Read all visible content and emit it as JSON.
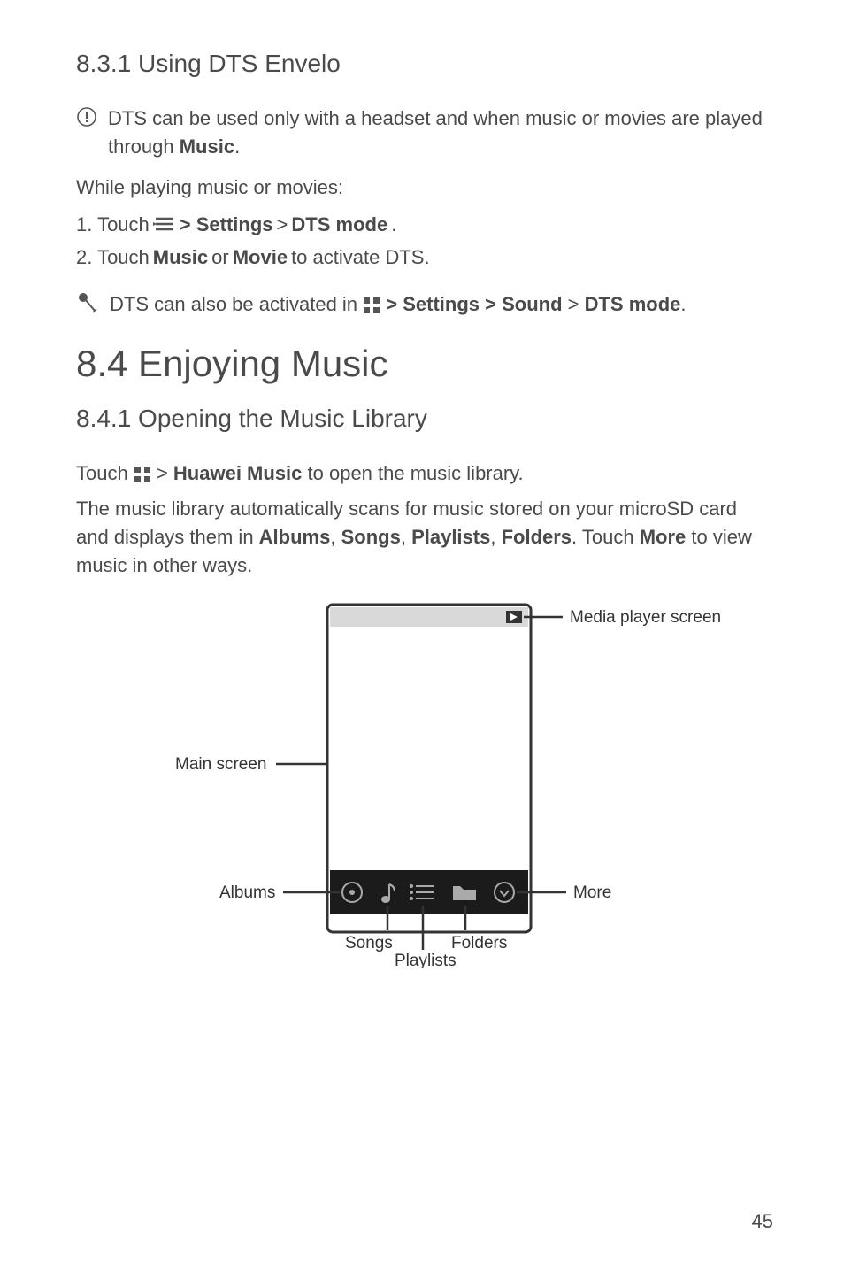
{
  "section_8_3_1": {
    "heading": "8.3.1  Using DTS Envelo",
    "note": {
      "pre": "DTS can be used only with a headset and when music or movies are played through ",
      "bold": "Music",
      "post": "."
    },
    "intro": "While playing music or movies:",
    "step1": {
      "pre": "1. Touch ",
      "mid": " > Settings",
      "gt": " > ",
      "bold2": "DTS mode",
      "post": "."
    },
    "step2": {
      "pre": "2.  Touch ",
      "b1": "Music",
      "or": " or ",
      "b2": "Movie",
      "post": " to activate DTS."
    },
    "tip": {
      "pre": "DTS can also be activated in ",
      "mid": " > Settings > Sound",
      "gt": " > ",
      "bold2": "DTS mode",
      "post": "."
    }
  },
  "section_8_4": {
    "heading": "8.4  Enjoying Music"
  },
  "section_8_4_1": {
    "heading": "8.4.1  Opening the Music Library",
    "line1": {
      "pre": "Touch ",
      "gt": " > ",
      "bold": "Huawei Music",
      "post": " to open the music library."
    },
    "para2_a": "The music library automatically scans for music stored on your microSD card and displays them in ",
    "para2_b1": "Albums",
    "para2_c1": ", ",
    "para2_b2": "Songs",
    "para2_c2": ", ",
    "para2_b3": "Playlists",
    "para2_c3": ", ",
    "para2_b4": "Folders",
    "para2_c4": ". Touch ",
    "para2_b5": "More",
    "para2_c5": " to view music in other ways."
  },
  "diagram": {
    "media_player": "Media player screen",
    "main_screen": "Main screen",
    "albums": "Albums",
    "songs": "Songs",
    "playlists": "Playlists",
    "folders": "Folders",
    "more": "More"
  },
  "page_number": "45"
}
